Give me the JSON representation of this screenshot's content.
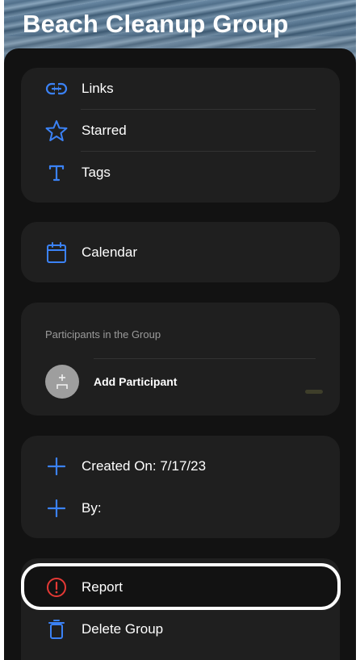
{
  "header": {
    "title": "Beach Cleanup Group"
  },
  "content_card": {
    "items": [
      {
        "label": "Links",
        "icon": "link-icon"
      },
      {
        "label": "Starred",
        "icon": "star-icon"
      },
      {
        "label": "Tags",
        "icon": "text-icon"
      }
    ]
  },
  "calendar_card": {
    "label": "Calendar",
    "icon": "calendar-icon"
  },
  "participants_card": {
    "caption": "Participants in the Group",
    "add_label": "Add Participant",
    "icon": "add-person-icon"
  },
  "info_card": {
    "created_label": "Created On: 7/17/23",
    "by_label": "By:"
  },
  "actions_card": {
    "report_label": "Report",
    "delete_label": "Delete Group"
  },
  "colors": {
    "accent": "#3b82f6",
    "danger": "#e53935",
    "background": "#121212",
    "card": "#1f1f1f"
  }
}
